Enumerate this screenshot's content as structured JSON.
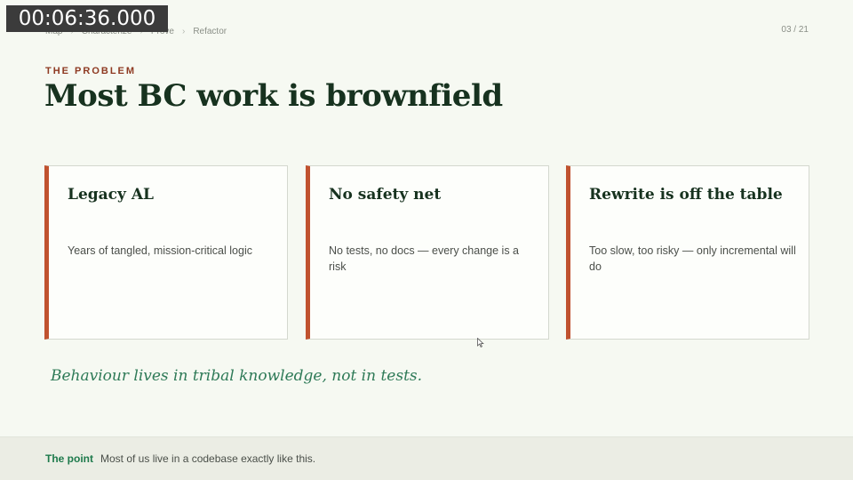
{
  "overlay": {
    "timecode": "00:06:36.000"
  },
  "breadcrumb": {
    "items": [
      "Map",
      "Characterize",
      "Prove",
      "Refactor"
    ],
    "separator": "›"
  },
  "page_counter": "03 / 21",
  "eyebrow": "THE PROBLEM",
  "title": "Most BC work is brownfield",
  "cards": [
    {
      "title": "Legacy AL",
      "body": "Years of tangled, mission-critical logic"
    },
    {
      "title": "No safety net",
      "body": "No tests, no docs — every change is a risk"
    },
    {
      "title": "Rewrite is off the table",
      "body": "Too slow, too risky — only incremental will do"
    }
  ],
  "quote": "Behaviour lives in tribal knowledge, not in tests.",
  "footer": {
    "label": "The point",
    "text": "Most of us live in a codebase exactly like this."
  },
  "colors": {
    "accent": "#c0522f",
    "eyebrow": "#8e3a22",
    "title": "#17321f",
    "quote": "#2e7a57",
    "footer_label": "#1e7a4c"
  }
}
